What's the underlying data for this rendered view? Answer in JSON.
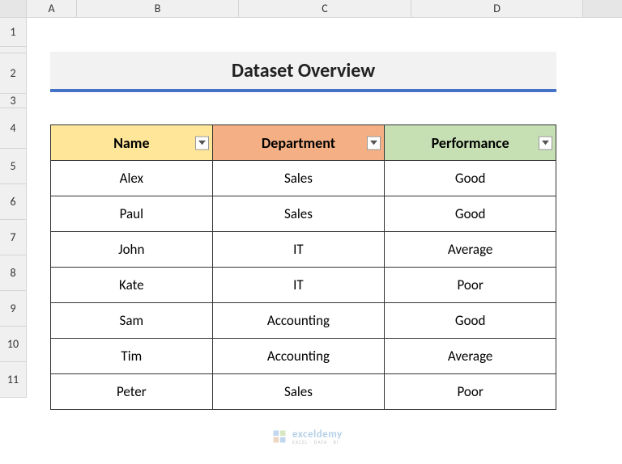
{
  "columns": [
    "",
    "A",
    "B",
    "C",
    "D"
  ],
  "rows": [
    "1",
    "2",
    "3",
    "4",
    "5",
    "6",
    "7",
    "8",
    "9",
    "10",
    "11"
  ],
  "title": "Dataset Overview",
  "headers": {
    "name": "Name",
    "department": "Department",
    "performance": "Performance"
  },
  "data": [
    {
      "name": "Alex",
      "department": "Sales",
      "performance": "Good"
    },
    {
      "name": "Paul",
      "department": "Sales",
      "performance": "Good"
    },
    {
      "name": "John",
      "department": "IT",
      "performance": "Average"
    },
    {
      "name": "Kate",
      "department": "IT",
      "performance": "Poor"
    },
    {
      "name": "Sam",
      "department": "Accounting",
      "performance": "Good"
    },
    {
      "name": "Tim",
      "department": "Accounting",
      "performance": "Average"
    },
    {
      "name": "Peter",
      "department": "Sales",
      "performance": "Poor"
    }
  ],
  "watermark": {
    "title": "exceldemy",
    "sub": "EXCEL · DATA · BI"
  },
  "chart_data": {
    "type": "table",
    "title": "Dataset Overview",
    "columns": [
      "Name",
      "Department",
      "Performance"
    ],
    "rows": [
      [
        "Alex",
        "Sales",
        "Good"
      ],
      [
        "Paul",
        "Sales",
        "Good"
      ],
      [
        "John",
        "IT",
        "Average"
      ],
      [
        "Kate",
        "IT",
        "Poor"
      ],
      [
        "Sam",
        "Accounting",
        "Good"
      ],
      [
        "Tim",
        "Accounting",
        "Average"
      ],
      [
        "Peter",
        "Sales",
        "Poor"
      ]
    ]
  }
}
